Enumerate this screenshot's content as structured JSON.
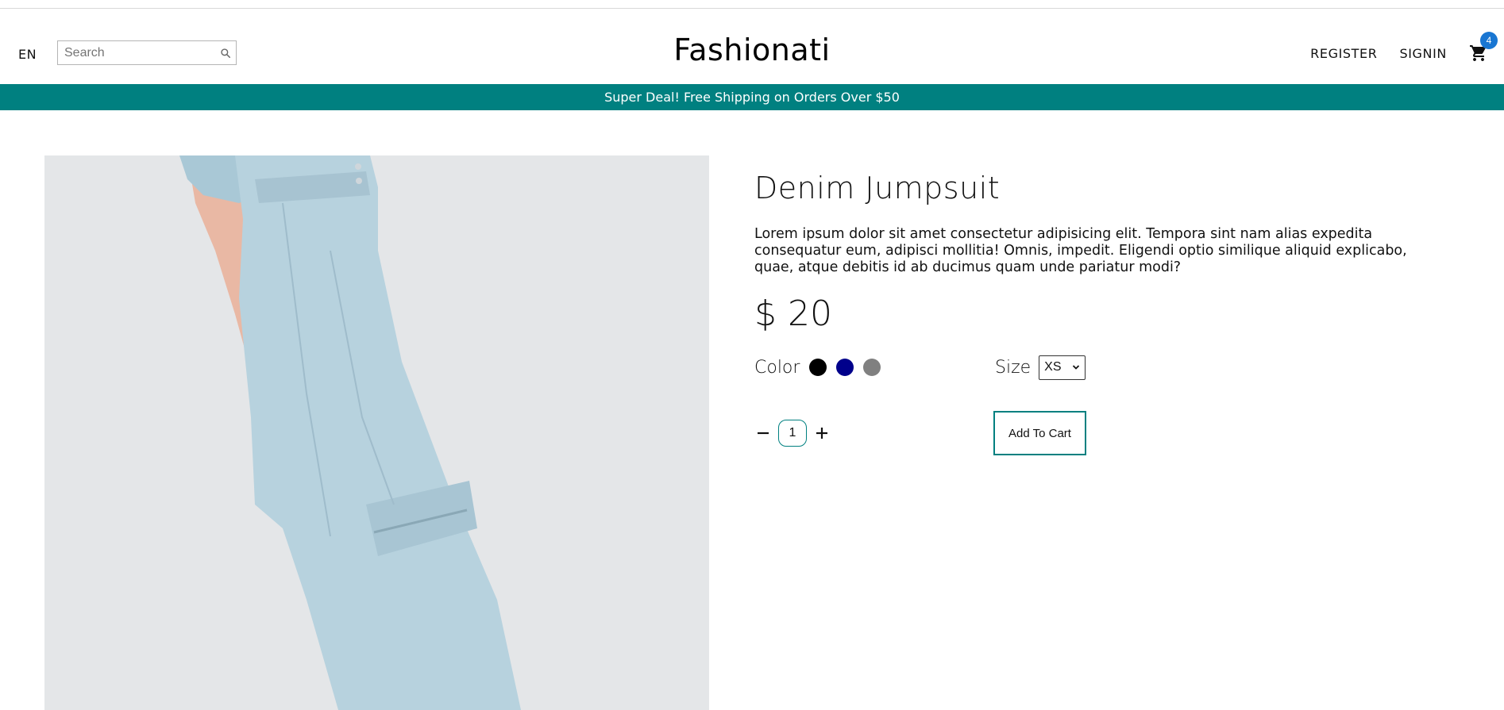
{
  "navbar": {
    "language": "EN",
    "search_placeholder": "Search",
    "logo": "Fashionati",
    "register": "REGISTER",
    "signin": "SIGNIN",
    "cart_count": "4"
  },
  "announcement": "Super Deal! Free Shipping on Orders Over $50",
  "product": {
    "title": "Denim Jumpsuit",
    "description": "Lorem ipsum dolor sit amet consectetur adipisicing elit. Tempora sint nam alias expedita consequatur eum, adipisci mollitia! Omnis, impedit. Eligendi optio similique aliquid explicabo, quae, atque debitis id ab ducimus quam unde pariatur modi?",
    "price": "$ 20",
    "color_label": "Color",
    "colors": [
      "#000000",
      "#00008b",
      "#808080"
    ],
    "size_label": "Size",
    "size_selected": "XS",
    "quantity": "1",
    "add_to_cart": "Add To Cart"
  },
  "icons": {
    "search": "search-icon",
    "cart": "shopping-cart-icon",
    "minus": "minus-icon",
    "plus": "plus-icon",
    "chevron": "chevron-down-icon"
  },
  "colors": {
    "accent": "#008080",
    "badge": "#1976d2"
  }
}
